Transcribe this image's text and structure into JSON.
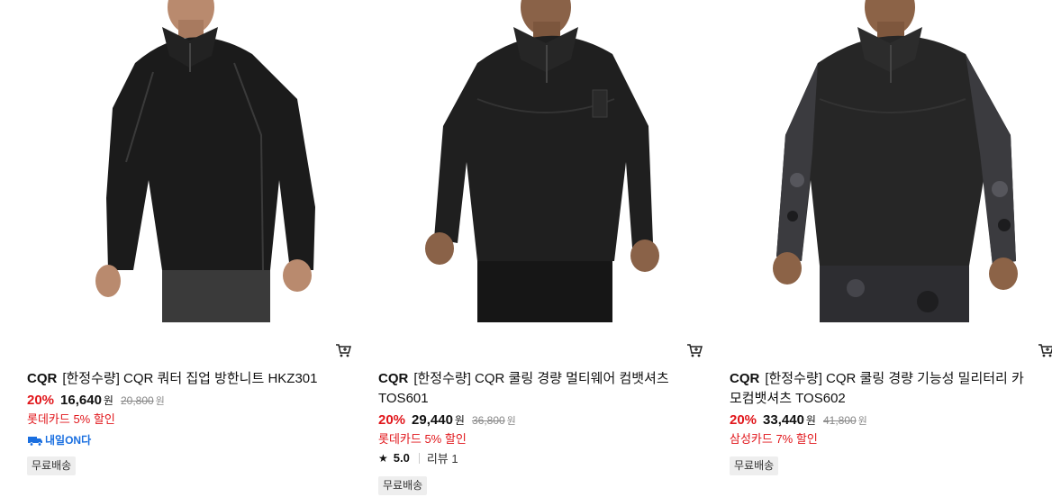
{
  "products": [
    {
      "brand": "CQR",
      "title": "[한정수량] CQR 쿼터 집업 방한니트 HKZ301",
      "discount": "20%",
      "price": "16,640",
      "won": "원",
      "original_price": "20,800",
      "promo": "롯데카드 5% 할인",
      "badge": "내일ON다",
      "shipping": "무료배송"
    },
    {
      "brand": "CQR",
      "title": "[한정수량] CQR 쿨링 경량 멀티웨어 컴뱃셔츠 TOS601",
      "discount": "20%",
      "price": "29,440",
      "won": "원",
      "original_price": "36,800",
      "promo": "롯데카드 5% 할인",
      "rating": "5.0",
      "reviews": "리뷰 1",
      "shipping": "무료배송"
    },
    {
      "brand": "CQR",
      "title": "[한정수량] CQR 쿨링 경량 기능성 밀리터리 카모컴뱃셔츠 TOS602",
      "discount": "20%",
      "price": "33,440",
      "won": "원",
      "original_price": "41,800",
      "promo": "삼성카드 7% 할인",
      "shipping": "무료배송"
    }
  ],
  "icons": {
    "cart": "cart-icon",
    "star": "star-icon",
    "badge": "delivery-truck-icon"
  },
  "colors": {
    "discount": "#e1161b",
    "badge": "#1a6fe0",
    "ship_bg": "#eeeeee"
  }
}
